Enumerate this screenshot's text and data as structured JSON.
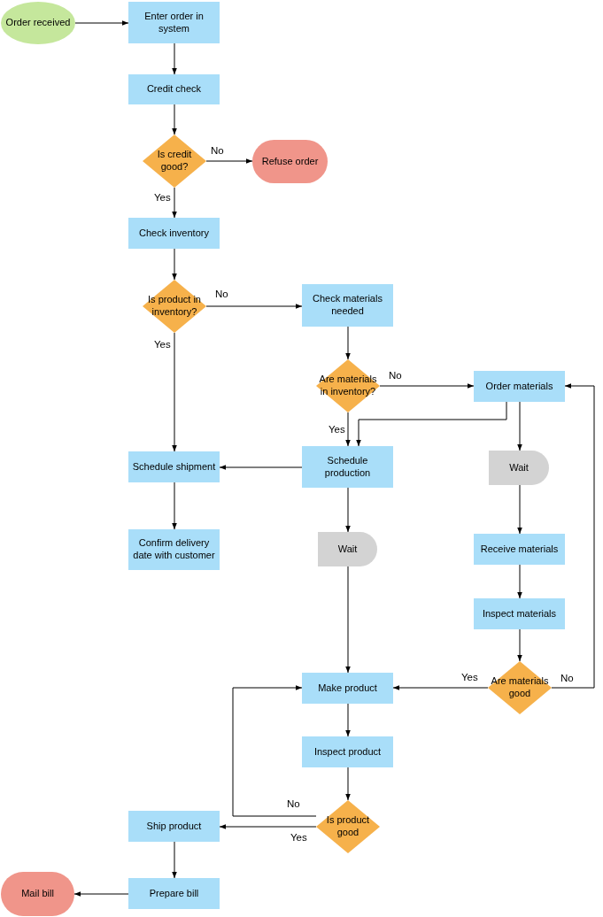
{
  "nodes": [
    {
      "kind": "start",
      "label": "Order received"
    },
    {
      "kind": "process",
      "label": "Enter order in system"
    },
    {
      "kind": "process",
      "label": "Credit check"
    },
    {
      "kind": "decision",
      "label": "Is credit good?"
    },
    {
      "kind": "end",
      "label": "Refuse order"
    },
    {
      "kind": "process",
      "label": "Check inventory"
    },
    {
      "kind": "decision",
      "label": "Is product in inventory?"
    },
    {
      "kind": "process",
      "label": "Check materials needed"
    },
    {
      "kind": "decision",
      "label": "Are materials in inventory?"
    },
    {
      "kind": "process",
      "label": "Order materials"
    },
    {
      "kind": "process",
      "label": "Schedule shipment"
    },
    {
      "kind": "process",
      "label": "Schedule production"
    },
    {
      "kind": "delay",
      "label": "Wait"
    },
    {
      "kind": "process",
      "label": "Confirm delivery date with customer"
    },
    {
      "kind": "delay",
      "label": "Wait"
    },
    {
      "kind": "process",
      "label": "Receive materials"
    },
    {
      "kind": "process",
      "label": "Inspect materials"
    },
    {
      "kind": "process",
      "label": "Make product"
    },
    {
      "kind": "decision",
      "label": "Are materials good"
    },
    {
      "kind": "process",
      "label": "Inspect product"
    },
    {
      "kind": "process",
      "label": "Ship product"
    },
    {
      "kind": "decision",
      "label": "Is product good"
    },
    {
      "kind": "process",
      "label": "Prepare bill"
    },
    {
      "kind": "end",
      "label": "Mail bill"
    }
  ],
  "edge_labels": [
    "No",
    "Yes",
    "No",
    "Yes",
    "No",
    "Yes",
    "Yes",
    "No",
    "No",
    "Yes"
  ]
}
